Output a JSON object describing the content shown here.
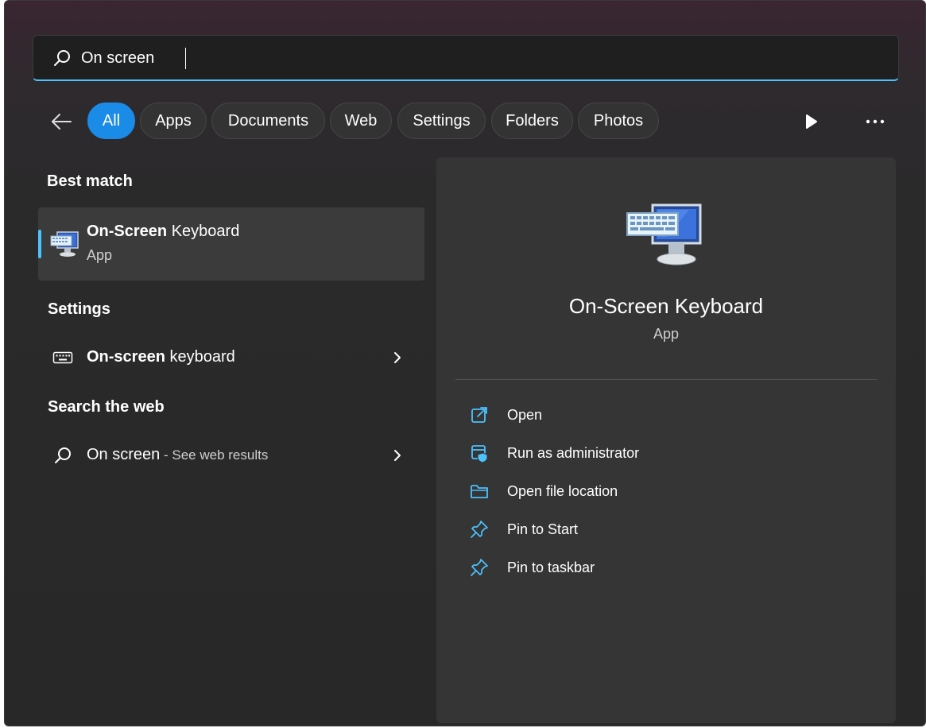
{
  "search": {
    "value": "On screen",
    "placeholder": ""
  },
  "filters": {
    "chips": [
      {
        "label": "All",
        "active": true
      },
      {
        "label": "Apps"
      },
      {
        "label": "Documents"
      },
      {
        "label": "Web"
      },
      {
        "label": "Settings"
      },
      {
        "label": "Folders"
      },
      {
        "label": "Photos"
      }
    ]
  },
  "best_match": {
    "header": "Best match",
    "title_bold": "On-Screen",
    "title_rest": " Keyboard",
    "subtitle": "App"
  },
  "settings": {
    "header": "Settings",
    "item_bold": "On-screen",
    "item_rest": " keyboard"
  },
  "web": {
    "header": "Search the web",
    "query": "On screen",
    "suffix": " - See web results"
  },
  "detail": {
    "title": "On-Screen Keyboard",
    "subtitle": "App",
    "actions": [
      {
        "label": "Open",
        "icon": "open-external-icon"
      },
      {
        "label": "Run as administrator",
        "icon": "shield-admin-icon"
      },
      {
        "label": "Open file location",
        "icon": "folder-icon"
      },
      {
        "label": "Pin to Start",
        "icon": "pin-icon"
      },
      {
        "label": "Pin to taskbar",
        "icon": "pin-icon"
      }
    ]
  },
  "colors": {
    "accent": "#4cc2ff",
    "chip_active": "#1a8be6",
    "panel": "#282828"
  }
}
